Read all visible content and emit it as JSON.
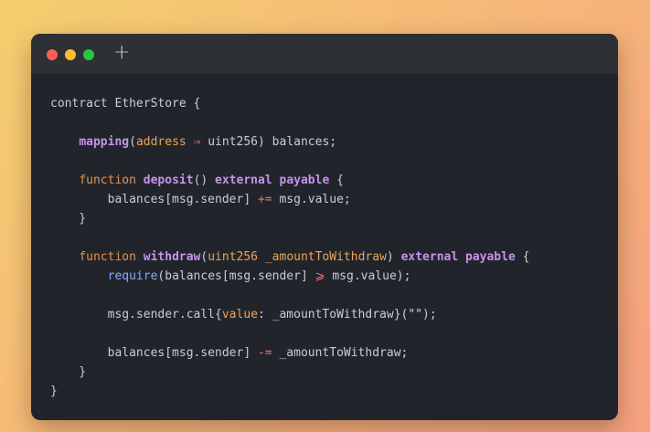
{
  "window": {
    "new_tab_label": "+",
    "traffic_lights": {
      "close_color": "#ff5f57",
      "minimize_color": "#febc2e",
      "maximize_color": "#28c840"
    }
  },
  "code": {
    "language": "solidity",
    "lines": [
      [
        {
          "t": "contract EtherStore {",
          "c": "plain"
        }
      ],
      [],
      [
        {
          "t": "    ",
          "c": "plain"
        },
        {
          "t": "mapping",
          "c": "fn"
        },
        {
          "t": "(",
          "c": "plain"
        },
        {
          "t": "address",
          "c": "type"
        },
        {
          "t": " ⇒ ",
          "c": "op"
        },
        {
          "t": "uint256",
          "c": "plain"
        },
        {
          "t": ") balances;",
          "c": "plain"
        }
      ],
      [],
      [
        {
          "t": "    ",
          "c": "plain"
        },
        {
          "t": "function",
          "c": "kw"
        },
        {
          "t": " ",
          "c": "plain"
        },
        {
          "t": "deposit",
          "c": "fn"
        },
        {
          "t": "() ",
          "c": "plain"
        },
        {
          "t": "external payable",
          "c": "fn"
        },
        {
          "t": " {",
          "c": "plain"
        }
      ],
      [
        {
          "t": "        balances[msg.sender] ",
          "c": "plain"
        },
        {
          "t": "+=",
          "c": "op"
        },
        {
          "t": " msg.value;",
          "c": "plain"
        }
      ],
      [
        {
          "t": "    }",
          "c": "plain"
        }
      ],
      [],
      [
        {
          "t": "    ",
          "c": "plain"
        },
        {
          "t": "function",
          "c": "kw"
        },
        {
          "t": " ",
          "c": "plain"
        },
        {
          "t": "withdraw",
          "c": "fn"
        },
        {
          "t": "(",
          "c": "plain"
        },
        {
          "t": "uint256",
          "c": "type"
        },
        {
          "t": " ",
          "c": "plain"
        },
        {
          "t": "_amountToWithdraw",
          "c": "type"
        },
        {
          "t": ") ",
          "c": "plain"
        },
        {
          "t": "external payable",
          "c": "fn"
        },
        {
          "t": " {",
          "c": "plain"
        }
      ],
      [
        {
          "t": "        ",
          "c": "plain"
        },
        {
          "t": "require",
          "c": "call"
        },
        {
          "t": "(balances[msg.sender] ",
          "c": "plain"
        },
        {
          "t": "⩾",
          "c": "op"
        },
        {
          "t": " msg.value);",
          "c": "plain"
        }
      ],
      [],
      [
        {
          "t": "        msg.sender.call{",
          "c": "plain"
        },
        {
          "t": "value",
          "c": "type"
        },
        {
          "t": ": _amountToWithdraw}(",
          "c": "plain"
        },
        {
          "t": "\"\"",
          "c": "str"
        },
        {
          "t": ");",
          "c": "plain"
        }
      ],
      [],
      [
        {
          "t": "        balances[msg.sender] ",
          "c": "plain"
        },
        {
          "t": "-=",
          "c": "op"
        },
        {
          "t": " _amountToWithdraw;",
          "c": "plain"
        }
      ],
      [
        {
          "t": "    }",
          "c": "plain"
        }
      ],
      [
        {
          "t": "}",
          "c": "plain"
        }
      ]
    ]
  }
}
